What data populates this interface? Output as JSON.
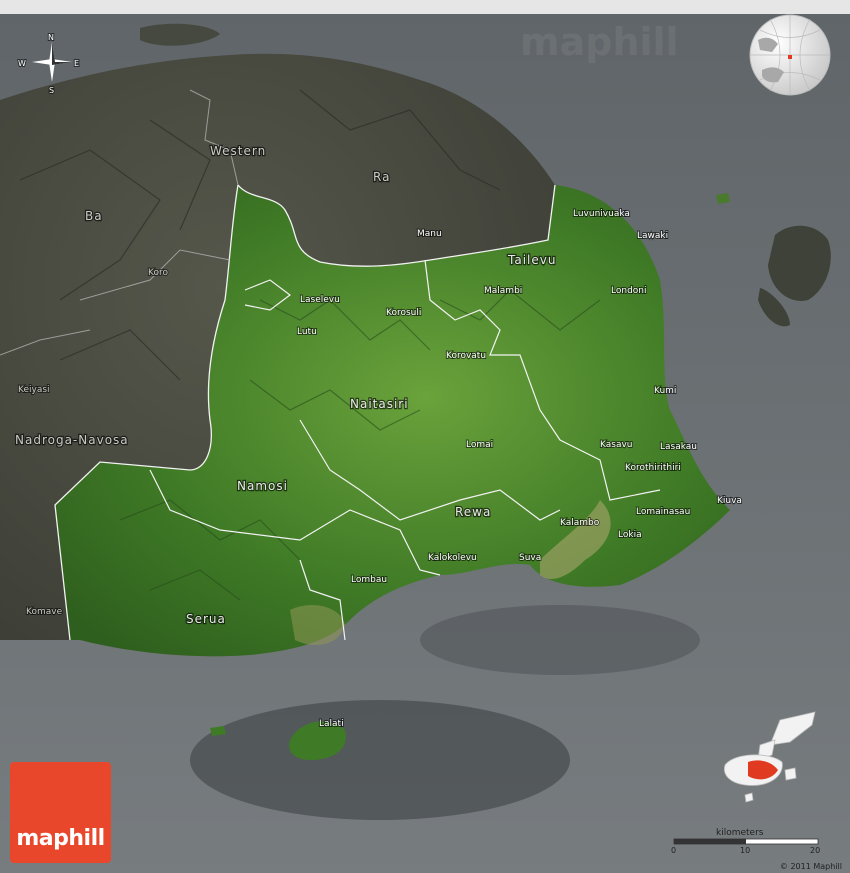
{
  "map": {
    "watermark": "maphill",
    "copyright": "© 2011 Maphill",
    "logo_text": "maphill",
    "compass": {
      "n": "N",
      "s": "S",
      "e": "E",
      "w": "W"
    },
    "scale": {
      "title": "kilometers",
      "ticks": [
        "0",
        "10",
        "20"
      ]
    },
    "colors": {
      "sea": "#6b7073",
      "highlight_land": "#4f8a2e",
      "dark_land": "#4a4c42",
      "inset_highlight": "#e03a20",
      "logo": "#e8472b"
    },
    "provinces": [
      {
        "name": "Western"
      },
      {
        "name": "Ra"
      },
      {
        "name": "Ba"
      },
      {
        "name": "Nadroga-Navosa"
      },
      {
        "name": "Tailevu"
      },
      {
        "name": "Naitasiri"
      },
      {
        "name": "Namosi"
      },
      {
        "name": "Rewa"
      },
      {
        "name": "Serua"
      }
    ],
    "places": [
      {
        "name": "Luvunivuaka"
      },
      {
        "name": "Lawaki"
      },
      {
        "name": "Manu"
      },
      {
        "name": "Malambi"
      },
      {
        "name": "Londoni"
      },
      {
        "name": "Koro"
      },
      {
        "name": "Laselevu"
      },
      {
        "name": "Korosuli"
      },
      {
        "name": "Lutu"
      },
      {
        "name": "Korovatu"
      },
      {
        "name": "Kumi"
      },
      {
        "name": "Keiyasi"
      },
      {
        "name": "Lomai"
      },
      {
        "name": "Kasavu"
      },
      {
        "name": "Lasakau"
      },
      {
        "name": "Korothirithiri"
      },
      {
        "name": "Kiuva"
      },
      {
        "name": "Lomainasau"
      },
      {
        "name": "Kalambo"
      },
      {
        "name": "Lokia"
      },
      {
        "name": "Kalokolevu"
      },
      {
        "name": "Suva"
      },
      {
        "name": "Lombau"
      },
      {
        "name": "Komave"
      },
      {
        "name": "Lalati"
      }
    ]
  }
}
